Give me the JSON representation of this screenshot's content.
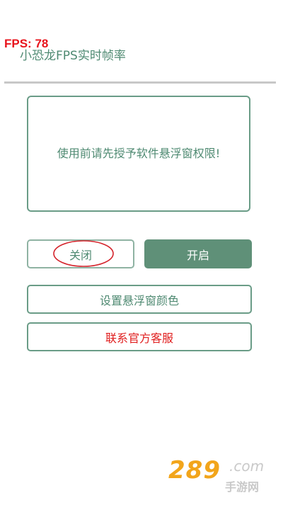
{
  "overlay": {
    "fps_text": "FPS: 78"
  },
  "app": {
    "title": "小恐龙FPS实时帧率"
  },
  "message": {
    "text": "使用前请先授予软件悬浮窗权限!"
  },
  "buttons": {
    "close_label": "关闭",
    "open_label": "开启",
    "color_label": "设置悬浮窗颜色",
    "contact_label": "联系官方客服"
  },
  "watermark": {
    "digits": "289",
    "domain": ".com",
    "subtitle": "手游网"
  },
  "colors": {
    "accent": "#5f9078",
    "text_green": "#4f8a72",
    "fps_red": "#e8141c",
    "contact_red": "#e01e1e",
    "annotation_red": "#d4242c"
  }
}
